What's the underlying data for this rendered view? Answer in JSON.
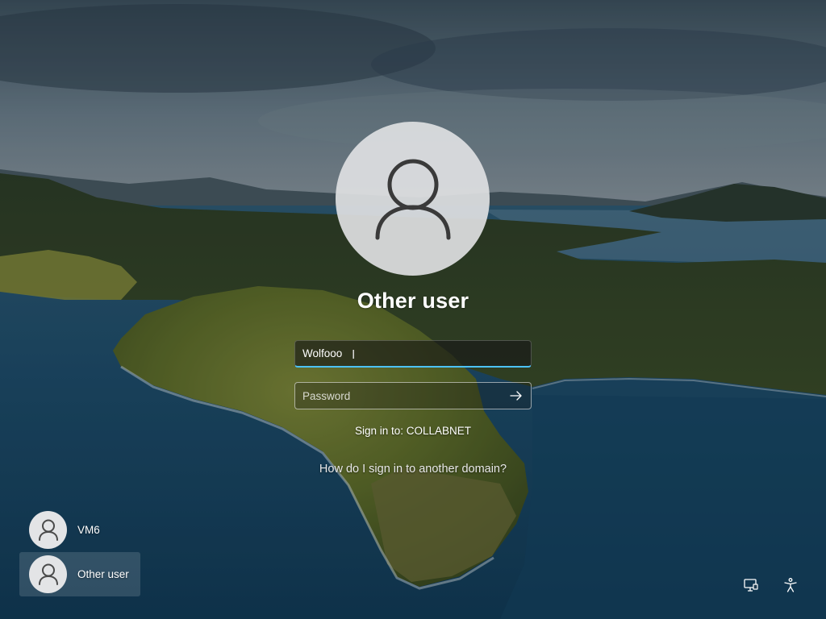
{
  "signin": {
    "display_name": "Other user",
    "username_value": "Wolfooo",
    "password_placeholder": "Password",
    "sign_in_to": "Sign in to: COLLABNET",
    "domain_help_link": "How do I sign in to another domain?"
  },
  "user_list": {
    "items": [
      {
        "name": "VM6",
        "selected": false
      },
      {
        "name": "Other user",
        "selected": true
      }
    ]
  },
  "icons": {
    "user": "person-outline-icon",
    "submit": "arrow-right-icon",
    "network": "network-icon",
    "accessibility": "accessibility-icon"
  },
  "colors": {
    "focus_underline": "#4cc2ff",
    "text": "#ffffff"
  }
}
